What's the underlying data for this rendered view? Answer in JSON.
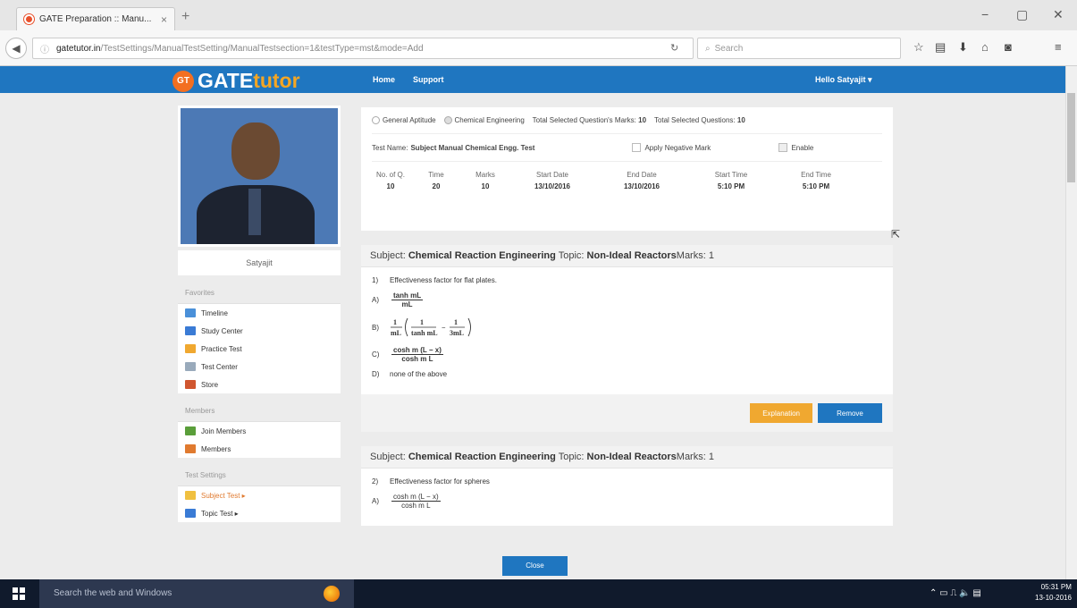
{
  "browser": {
    "tab_title": "GATE Preparation :: Manu...",
    "tab_close": "×",
    "new_tab": "+",
    "url_host": "gatetutor.in",
    "url_path": "/TestSettings/ManualTestSetting/ManualTestsection=1&testType=mst&mode=Add",
    "search_placeholder": "Search"
  },
  "site": {
    "logo_badge": "GT",
    "logo_gate": "GATE",
    "logo_tutor": "tutor",
    "nav": [
      "Home",
      "Support"
    ],
    "hello": "Hello Satyajit ▾"
  },
  "sidebar": {
    "username": "Satyajit",
    "favorites_title": "Favorites",
    "favorites": [
      "Timeline",
      "Study Center",
      "Practice Test",
      "Test Center",
      "Store"
    ],
    "members_title": "Members",
    "members": [
      "Join Members",
      "Members"
    ],
    "settings_title": "Test Settings",
    "settings": [
      "Subject Test ▸",
      "Topic Test ▸"
    ]
  },
  "test": {
    "radio_1": "General Aptitude",
    "radio_2": "Chemical Engineering",
    "total_marks_label": "Total Selected Question's Marks:",
    "total_marks": "10",
    "total_q_label": "Total Selected Questions:",
    "total_q": "10",
    "test_name_label": "Test Name:",
    "test_name": "Subject Manual Chemical Engg. Test",
    "negative_mark": "Apply Negative Mark",
    "enable": "Enable",
    "stats": [
      {
        "label": "No. of Q.",
        "value": "10"
      },
      {
        "label": "Time",
        "value": "20"
      },
      {
        "label": "Marks",
        "value": "10"
      },
      {
        "label": "Start Date",
        "value": "13/10/2016"
      },
      {
        "label": "End Date",
        "value": "13/10/2016"
      },
      {
        "label": "Start Time",
        "value": "5:10 PM"
      },
      {
        "label": "End Time",
        "value": "5:10 PM"
      }
    ]
  },
  "q1": {
    "subject_label": "Subject:",
    "subject": "Chemical Reaction Engineering",
    "topic_label": "Topic:",
    "topic": "Non-Ideal Reactors",
    "marks": "Marks: 1",
    "number": "1)",
    "text": "Effectiveness factor for flat plates.",
    "opt_a": "A)",
    "opt_a_num": "tanh mL",
    "opt_a_den": "mL",
    "opt_b": "B)",
    "opt_c": "C)",
    "opt_c_num": "cosh m (L − x)",
    "opt_c_den": "cosh m L",
    "opt_d": "D)",
    "opt_d_text": "none of the above",
    "explanation": "Explanation",
    "remove": "Remove"
  },
  "q2": {
    "subject_label": "Subject:",
    "subject": "Chemical Reaction Engineering",
    "topic_label": "Topic:",
    "topic": "Non-Ideal Reactors",
    "marks": "Marks: 1",
    "number": "2)",
    "text": "Effectiveness factor for spheres",
    "opt_a": "A)",
    "opt_a_num": "cosh m (L − x)",
    "opt_a_den": "cosh m L"
  },
  "close": "Close",
  "taskbar": {
    "search": "Search the web and Windows",
    "time": "05:31 PM",
    "date": "13-10-2016"
  },
  "colors": {
    "header": "#1f76c0",
    "explanation_btn": "#f0a830",
    "remove_btn": "#1f76c0"
  }
}
